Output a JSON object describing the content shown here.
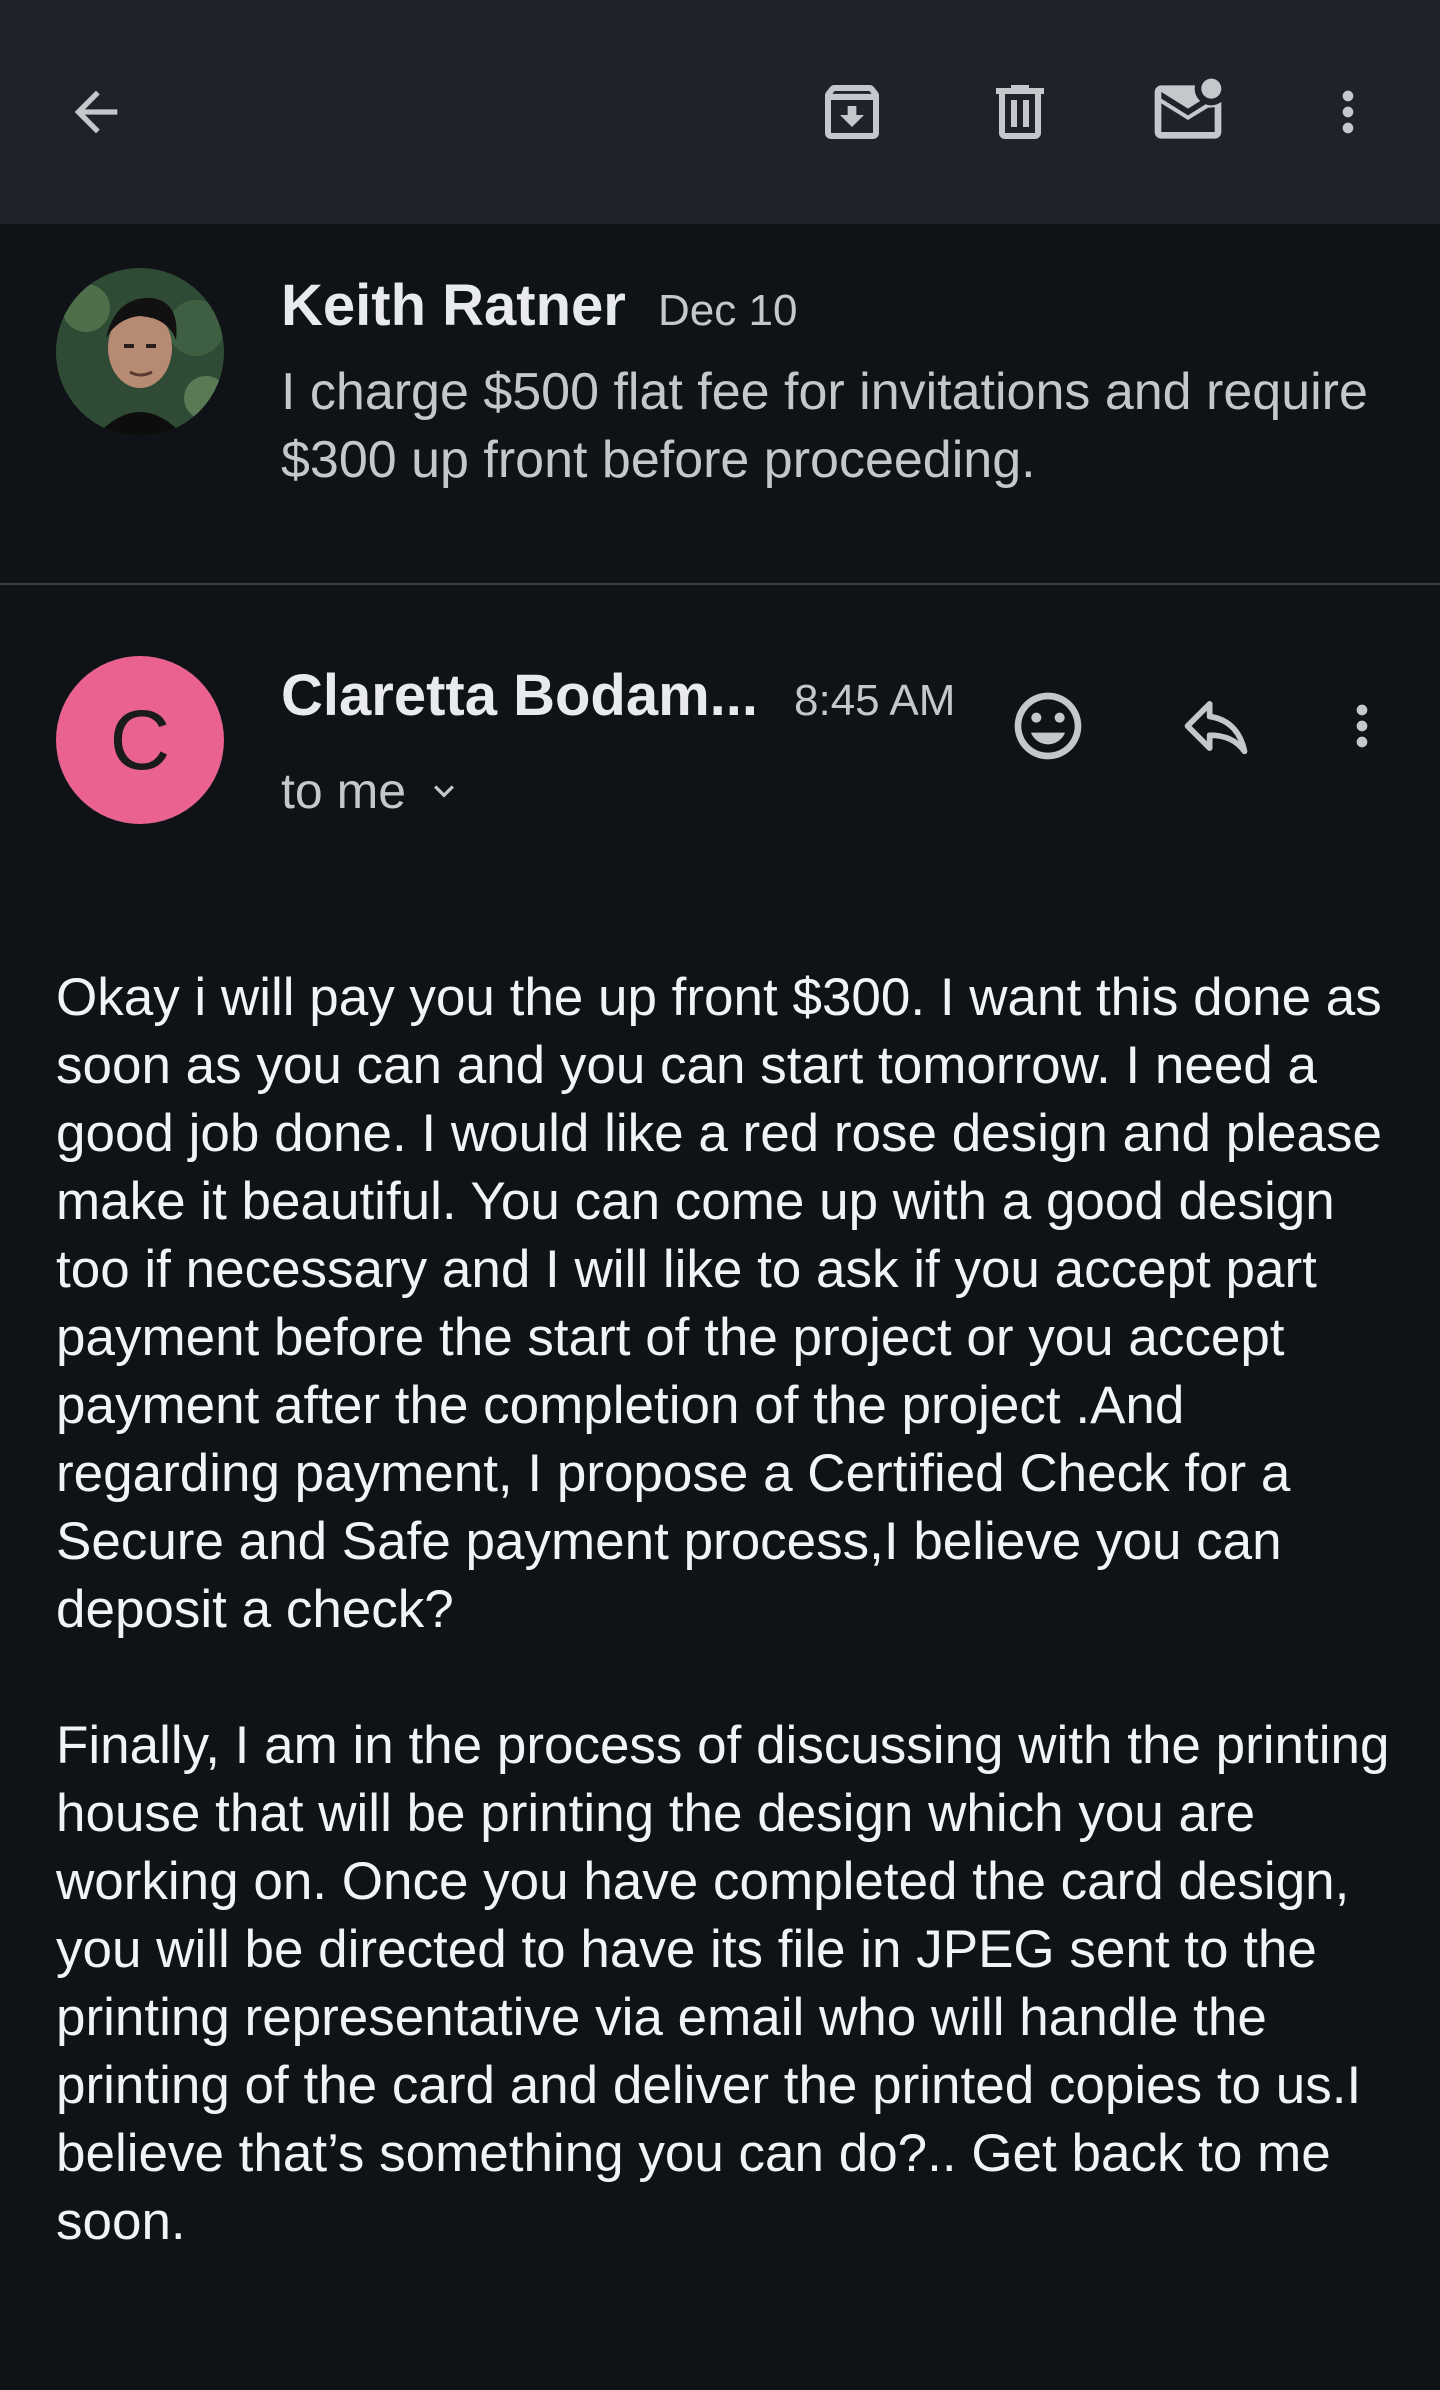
{
  "toolbar": {
    "icons": [
      "back-arrow-icon",
      "archive-icon",
      "delete-icon",
      "mark-unread-icon",
      "more-vert-icon"
    ]
  },
  "previous_message": {
    "sender": "Keith Ratner",
    "date": "Dec 10",
    "snippet": "I charge $500 flat fee for invitations and require $300 up front before proceeding."
  },
  "current_message": {
    "avatar_letter": "C",
    "avatar_color": "#e96290",
    "sender": "Claretta Bodam...",
    "time": "8:45 AM",
    "recipient_label": "to me",
    "actions": [
      "emoji-reaction-icon",
      "reply-icon",
      "more-vert-icon"
    ],
    "body": [
      "Okay i will pay you the up front $300. I want this done as soon as you can and you can start tomorrow. I need a good job done. I would like a red rose design and please make it beautiful. You can come up with a good design too if necessary and I will like to ask if you accept part payment before the start of the project or you accept payment after the completion of the project .And regarding payment, I propose a Certified Check for a Secure and Safe payment process,I believe you can deposit a check?",
      "Finally, I am in the process of discussing with the printing house that will be printing the design which you are working on. Once you have completed the card design, you will be directed to have its file in JPEG sent to the printing representative via email who will handle the printing of the card and deliver the printed copies to us.I believe that’s something you can do?.. Get back to me soon."
    ]
  },
  "colors": {
    "background": "#0f1216",
    "toolbar": "#1f2329",
    "text_primary": "#e8eaed",
    "text_secondary": "#c4c7cc"
  }
}
